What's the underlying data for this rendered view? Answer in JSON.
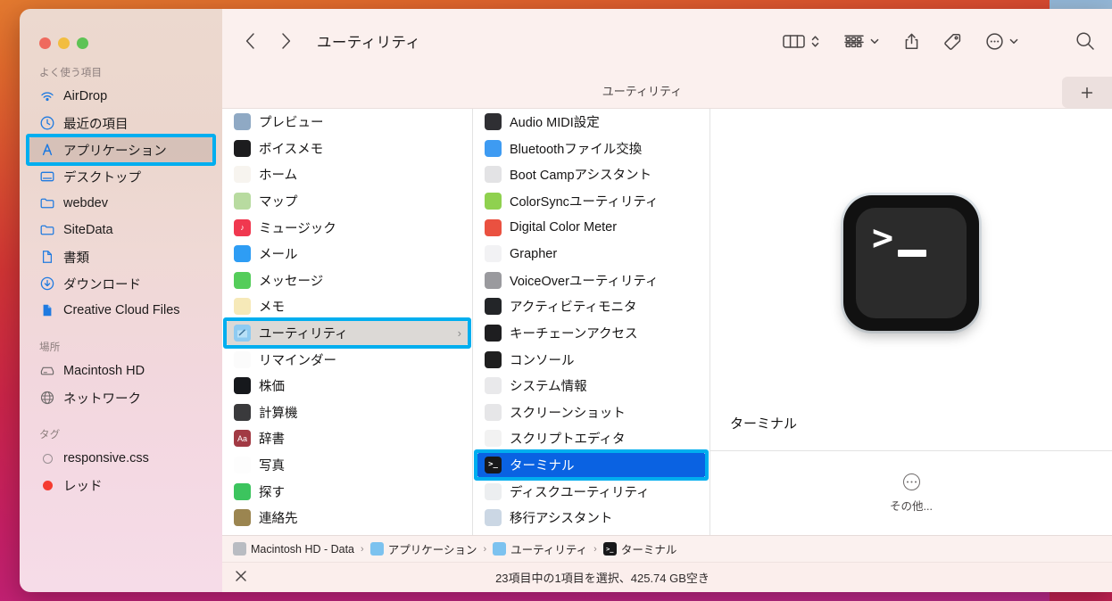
{
  "window": {
    "title": "ユーティリティ",
    "tab_label": "ユーティリティ",
    "new_tab_label": "+",
    "traffic": {
      "close": "閉じる",
      "minimize": "最小化",
      "zoom": "拡大"
    }
  },
  "toolbar": {
    "back": "戻る",
    "forward": "進む",
    "view_columns": "表示方法",
    "group_by": "グループ分け",
    "share": "共有",
    "tags": "タグ",
    "more": "その他の操作",
    "search": "検索"
  },
  "sidebar": {
    "sections": [
      {
        "title": "よく使う項目",
        "items": [
          {
            "label": "AirDrop",
            "icon": "airdrop-icon",
            "selected": false
          },
          {
            "label": "最近の項目",
            "icon": "clock-icon",
            "selected": false
          },
          {
            "label": "アプリケーション",
            "icon": "applications-icon",
            "selected": true
          },
          {
            "label": "デスクトップ",
            "icon": "desktop-icon",
            "selected": false
          },
          {
            "label": "webdev",
            "icon": "folder-icon",
            "selected": false
          },
          {
            "label": "SiteData",
            "icon": "folder-icon",
            "selected": false
          },
          {
            "label": "書類",
            "icon": "document-icon",
            "selected": false
          },
          {
            "label": "ダウンロード",
            "icon": "download-icon",
            "selected": false
          },
          {
            "label": "Creative Cloud Files",
            "icon": "cc-file-icon",
            "selected": false
          }
        ]
      },
      {
        "title": "場所",
        "items": [
          {
            "label": "Macintosh HD",
            "icon": "harddisk-icon",
            "selected": false
          },
          {
            "label": "ネットワーク",
            "icon": "globe-icon",
            "selected": false
          }
        ]
      },
      {
        "title": "タグ",
        "items": [
          {
            "label": "responsive.css",
            "icon": "tag-hollow-icon",
            "selected": false
          },
          {
            "label": "レッド",
            "icon": "tag-red-icon",
            "selected": false
          }
        ]
      }
    ]
  },
  "columns": {
    "applications": [
      {
        "label": "プレビュー",
        "icon": "preview-app",
        "color": "#8fa9c4",
        "glyph": "",
        "selected": false,
        "chevron": false
      },
      {
        "label": "ボイスメモ",
        "icon": "voicememos-app",
        "color": "#1c1c1e",
        "glyph": "",
        "selected": false,
        "chevron": false
      },
      {
        "label": "ホーム",
        "icon": "home-app",
        "color": "#f7f4ef",
        "glyph": "",
        "selected": false,
        "chevron": false
      },
      {
        "label": "マップ",
        "icon": "maps-app",
        "color": "#b8dba0",
        "glyph": "",
        "selected": false,
        "chevron": false
      },
      {
        "label": "ミュージック",
        "icon": "music-app",
        "color": "#f0384f",
        "glyph": "♪",
        "selected": false,
        "chevron": false
      },
      {
        "label": "メール",
        "icon": "mail-app",
        "color": "#2e9df4",
        "glyph": "",
        "selected": false,
        "chevron": false
      },
      {
        "label": "メッセージ",
        "icon": "messages-app",
        "color": "#54cd5a",
        "glyph": "",
        "selected": false,
        "chevron": false
      },
      {
        "label": "メモ",
        "icon": "notes-app",
        "color": "#f6e9b8",
        "glyph": "",
        "selected": false,
        "chevron": false
      },
      {
        "label": "ユーティリティ",
        "icon": "utilities-folder",
        "color": "#7cc2ef",
        "glyph": "",
        "selected": true,
        "chevron": true
      },
      {
        "label": "リマインダー",
        "icon": "reminders-app",
        "color": "#fbfbfb",
        "glyph": "",
        "selected": false,
        "chevron": false
      },
      {
        "label": "株価",
        "icon": "stocks-app",
        "color": "#16181c",
        "glyph": "",
        "selected": false,
        "chevron": false
      },
      {
        "label": "計算機",
        "icon": "calculator-app",
        "color": "#3a3a3c",
        "glyph": "",
        "selected": false,
        "chevron": false
      },
      {
        "label": "辞書",
        "icon": "dictionary-app",
        "color": "#a23a44",
        "glyph": "Aa",
        "selected": false,
        "chevron": false
      },
      {
        "label": "写真",
        "icon": "photos-app",
        "color": "#fdfdfd",
        "glyph": "",
        "selected": false,
        "chevron": false
      },
      {
        "label": "探す",
        "icon": "findmy-app",
        "color": "#3cc45e",
        "glyph": "",
        "selected": false,
        "chevron": false
      },
      {
        "label": "連絡先",
        "icon": "contacts-app",
        "color": "#9b8550",
        "glyph": "",
        "selected": false,
        "chevron": false
      }
    ],
    "utilities": [
      {
        "label": "Audio MIDI設定",
        "icon": "audio-midi-app",
        "color": "#2f2f33",
        "glyph": "",
        "selected": false
      },
      {
        "label": "Bluetoothファイル交換",
        "icon": "bluetooth-app",
        "color": "#3e9bf2",
        "glyph": "",
        "selected": false
      },
      {
        "label": "Boot Campアシスタント",
        "icon": "bootcamp-app",
        "color": "#e3e3e5",
        "glyph": "",
        "selected": false
      },
      {
        "label": "ColorSyncユーティリティ",
        "icon": "colorsync-app",
        "color": "#8fd14f",
        "glyph": "",
        "selected": false
      },
      {
        "label": "Digital Color Meter",
        "icon": "digitalcolor-app",
        "color": "#ea5140",
        "glyph": "",
        "selected": false
      },
      {
        "label": "Grapher",
        "icon": "grapher-app",
        "color": "#f2f2f4",
        "glyph": "",
        "selected": false
      },
      {
        "label": "VoiceOverユーティリティ",
        "icon": "voiceover-app",
        "color": "#9a9a9e",
        "glyph": "",
        "selected": false
      },
      {
        "label": "アクティビティモニタ",
        "icon": "activitymonitor-app",
        "color": "#232528",
        "glyph": "",
        "selected": false
      },
      {
        "label": "キーチェーンアクセス",
        "icon": "keychain-app",
        "color": "#1e1e20",
        "glyph": "",
        "selected": false
      },
      {
        "label": "コンソール",
        "icon": "console-app",
        "color": "#1f1f1f",
        "glyph": "",
        "selected": false
      },
      {
        "label": "システム情報",
        "icon": "systeminfo-app",
        "color": "#e9e9eb",
        "glyph": "",
        "selected": false
      },
      {
        "label": "スクリーンショット",
        "icon": "screenshot-app",
        "color": "#e6e6e8",
        "glyph": "",
        "selected": false
      },
      {
        "label": "スクリプトエディタ",
        "icon": "scripteditor-app",
        "color": "#f2f2f2",
        "glyph": "",
        "selected": false
      },
      {
        "label": "ターミナル",
        "icon": "terminal-app",
        "color": "#18181a",
        "glyph": "",
        "selected": true
      },
      {
        "label": "ディスクユーティリティ",
        "icon": "diskutility-app",
        "color": "#eceef0",
        "glyph": "",
        "selected": false
      },
      {
        "label": "移行アシスタント",
        "icon": "migration-app",
        "color": "#cbd7e4",
        "glyph": "",
        "selected": false
      }
    ]
  },
  "preview": {
    "icon": "terminal-icon",
    "prompt": ">",
    "name": "ターミナル",
    "more_label": "その他...",
    "more_icon": "ellipsis-circle-icon"
  },
  "pathbar": {
    "crumbs": [
      {
        "label": "Macintosh HD - Data",
        "icon": "harddisk-icon",
        "color": "#b9bcc2"
      },
      {
        "label": "アプリケーション",
        "icon": "applications-folder",
        "color": "#7cc2ef"
      },
      {
        "label": "ユーティリティ",
        "icon": "utilities-folder",
        "color": "#7cc2ef"
      },
      {
        "label": "ターミナル",
        "icon": "terminal-app",
        "color": "#18181a"
      }
    ],
    "separator": "›"
  },
  "statusbar": {
    "close_icon": "close-icon",
    "text": "23項目中の1項目を選択、425.74 GB空き"
  },
  "annotations": {
    "accent_color": "#00aeef",
    "boxes": [
      {
        "name": "applications-sidebar-highlight"
      },
      {
        "name": "utilities-folder-highlight"
      },
      {
        "name": "terminal-item-highlight"
      }
    ]
  }
}
